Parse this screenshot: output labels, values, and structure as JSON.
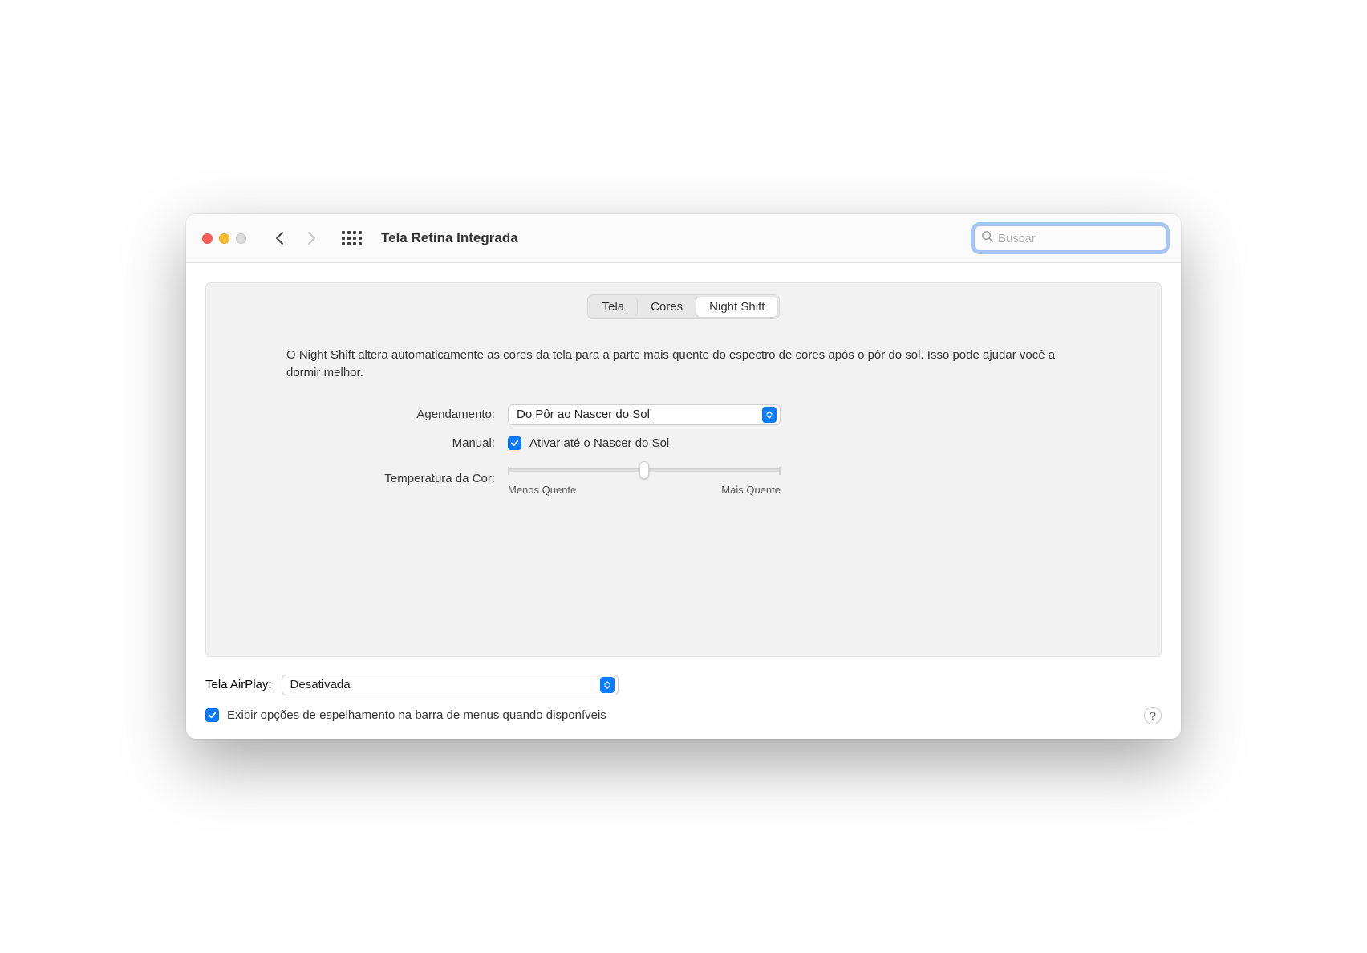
{
  "window": {
    "title": "Tela Retina Integrada"
  },
  "search": {
    "placeholder": "Buscar"
  },
  "tabs": {
    "tela": "Tela",
    "cores": "Cores",
    "nightshift": "Night Shift"
  },
  "description": "O Night Shift altera automaticamente as cores da tela para a parte mais quente do espectro de cores após o pôr do sol. Isso pode ajudar você a dormir melhor.",
  "labels": {
    "schedule": "Agendamento:",
    "manual": "Manual:",
    "colortemp": "Temperatura da Cor:",
    "airplay": "Tela AirPlay:"
  },
  "schedule_value": "Do Pôr ao Nascer do Sol",
  "manual_checkbox": "Ativar até o Nascer do Sol",
  "slider": {
    "less": "Menos Quente",
    "more": "Mais Quente"
  },
  "airplay_value": "Desativada",
  "mirroring_checkbox": "Exibir opções de espelhamento na barra de menus quando disponíveis",
  "help": "?"
}
